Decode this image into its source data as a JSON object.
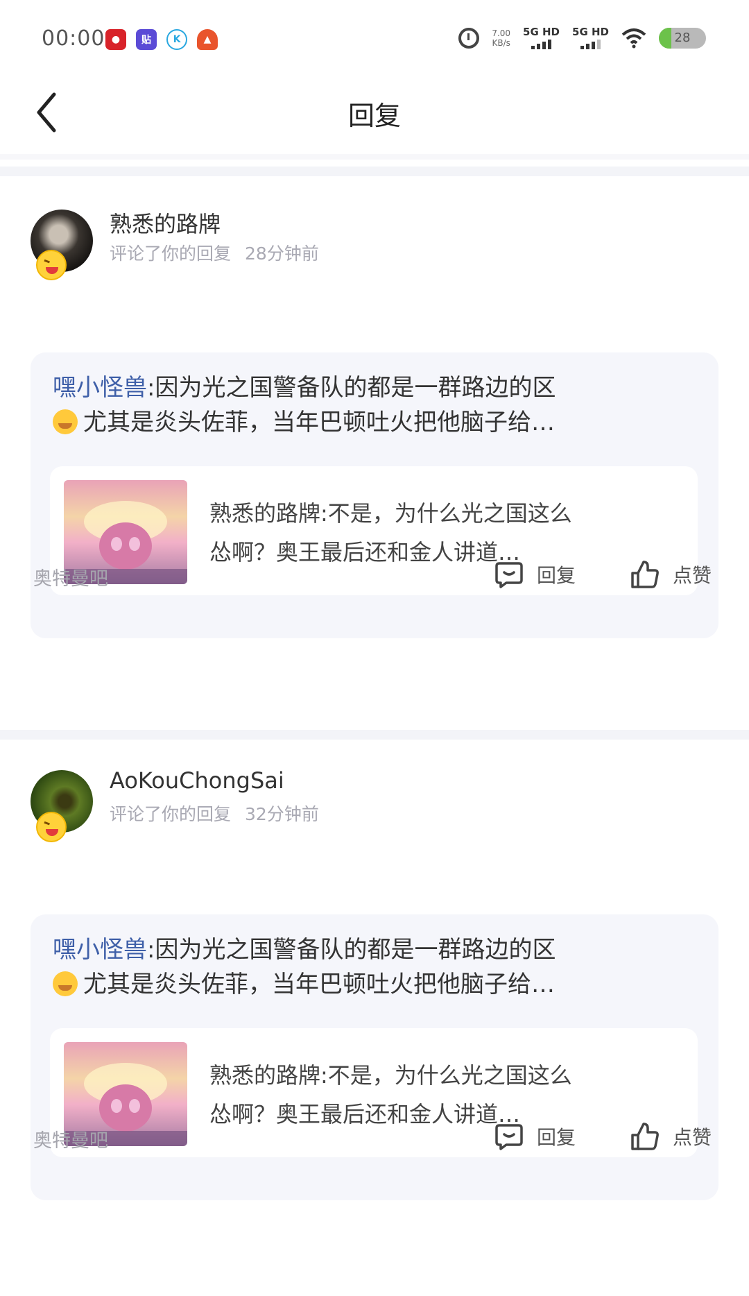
{
  "status_bar": {
    "time": "00:00",
    "speed_value": "7.00",
    "speed_unit": "KB/s",
    "network_1": "5G HD",
    "network_2": "5G HD",
    "battery": "28",
    "apps": [
      "app-red-icon",
      "tieba-icon",
      "k-app-icon",
      "game-app-icon"
    ]
  },
  "header": {
    "title": "回复"
  },
  "notifications": [
    {
      "username": "熟悉的路牌",
      "action": "评论了你的回复",
      "time": "28分钟前",
      "reply_emoji": "laughing-emoji-icon",
      "quote_author": "嘿小怪兽",
      "quote_line1": ":因为光之国警备队的都是一群路边的区",
      "quote_line2": "尤其是炎头佐菲，当年巴顿吐火把他脑子给…",
      "inner_line1": "熟悉的路牌:不是，为什么光之国这么",
      "inner_line2": "怂啊？奥王最后还和金人讲道…",
      "source": "奥特曼吧",
      "reply_label": "回复",
      "like_label": "点赞"
    },
    {
      "username": "AoKouChongSai",
      "action": "评论了你的回复",
      "time": "32分钟前",
      "reply_emoji": "laughing-emoji-icon",
      "quote_author": "嘿小怪兽",
      "quote_line1": ":因为光之国警备队的都是一群路边的区",
      "quote_line2": "尤其是炎头佐菲，当年巴顿吐火把他脑子给…",
      "inner_line1": "熟悉的路牌:不是，为什么光之国这么",
      "inner_line2": "怂啊？奥王最后还和金人讲道…",
      "source": "奥特曼吧",
      "reply_label": "回复",
      "like_label": "点赞"
    }
  ],
  "colors": {
    "accent_blue": "#3e5fa8",
    "card_bg": "#f5f6fb",
    "muted_text": "#a9a9b3"
  }
}
